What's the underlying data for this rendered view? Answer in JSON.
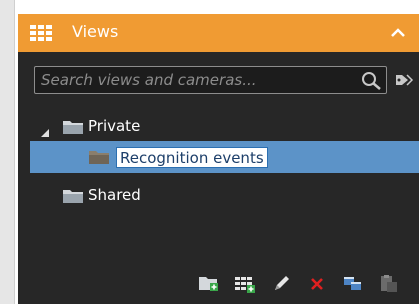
{
  "header": {
    "title": "Views"
  },
  "search": {
    "placeholder": "Search views and cameras..."
  },
  "tree": {
    "private_label": "Private",
    "selected_item_label": "Recognition events",
    "shared_label": "Shared"
  },
  "colors": {
    "header_bg": "#f09b33",
    "panel_bg": "#272727",
    "selection_bg": "#5c93c8",
    "delete_red": "#e02020"
  },
  "toolbar": {
    "icons": [
      "new-group-icon",
      "new-view-icon",
      "rename-icon",
      "delete-icon",
      "copy-icon",
      "paste-icon"
    ]
  }
}
